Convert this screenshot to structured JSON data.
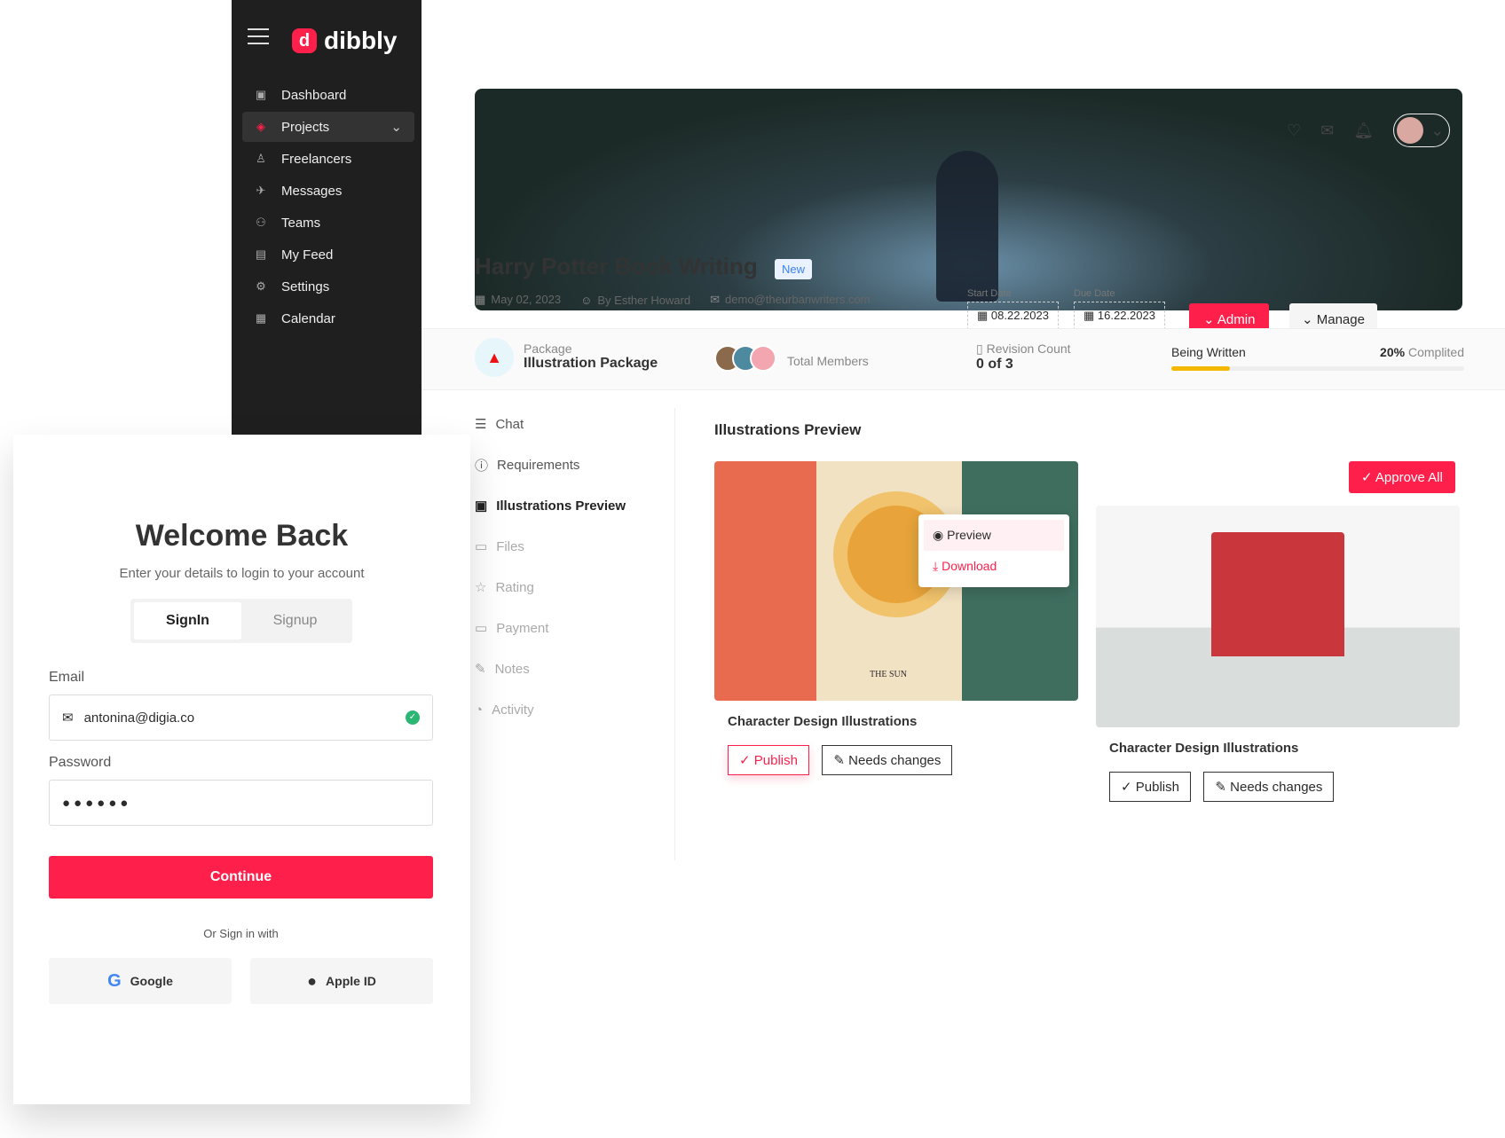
{
  "sidebar": {
    "brand": "dibbly",
    "items": [
      {
        "label": "Dashboard",
        "icon": "grid-icon"
      },
      {
        "label": "Projects",
        "icon": "layers-icon",
        "active": true
      },
      {
        "label": "Freelancers",
        "icon": "user-icon"
      },
      {
        "label": "Messages",
        "icon": "send-icon"
      },
      {
        "label": "Teams",
        "icon": "team-icon"
      },
      {
        "label": "My Feed",
        "icon": "feed-icon"
      },
      {
        "label": "Settings",
        "icon": "gear-icon"
      },
      {
        "label": "Calendar",
        "icon": "calendar-icon"
      }
    ]
  },
  "project": {
    "title": "Harry Potter Book Writing",
    "badge": "New",
    "date": "May 02, 2023",
    "author": "By Esther Howard",
    "email": "demo@theurbanwriters.com",
    "start_label": "Start Date",
    "start_date": "08.22.2023",
    "due_label": "Due Date",
    "due_date": "16.22.2023",
    "admin_label": "Admin",
    "manage_label": "Manage",
    "package_label": "Package",
    "package_value": "Illustration Package",
    "members_label": "Total Members",
    "revision_label": "Revision Count",
    "revision_value": "0 of 3",
    "status_label": "Being Written",
    "progress_percent": 20,
    "progress_text": "20%",
    "progress_suffix": "Complited"
  },
  "tabs": [
    "Chat",
    "Requirements",
    "Illustrations Preview",
    "Files",
    "Rating",
    "Payment",
    "Notes",
    "Activity"
  ],
  "preview": {
    "title": "Illustrations Preview",
    "approve_all": "Approve All",
    "menu": [
      "Preview",
      "Download"
    ],
    "cards": [
      {
        "caption": "Character Design Illustrations",
        "publish": "Publish",
        "changes": "Needs changes",
        "image_text": "THE SUN"
      },
      {
        "caption": "Character Design Illustrations",
        "publish": "Publish",
        "changes": "Needs changes"
      }
    ]
  },
  "login": {
    "title": "Welcome Back",
    "subtitle": "Enter your details to login to your account",
    "signin": "SignIn",
    "signup": "Signup",
    "email_label": "Email",
    "email_value": "antonina@digia.co",
    "password_label": "Password",
    "password_value": "●●●●●●",
    "continue": "Continue",
    "or_text": "Or Sign in with",
    "google": "Google",
    "apple": "Apple ID"
  },
  "colors": {
    "accent": "#ff1f4b",
    "sidebar": "#1f1f1f",
    "progress": "#f5b800"
  }
}
